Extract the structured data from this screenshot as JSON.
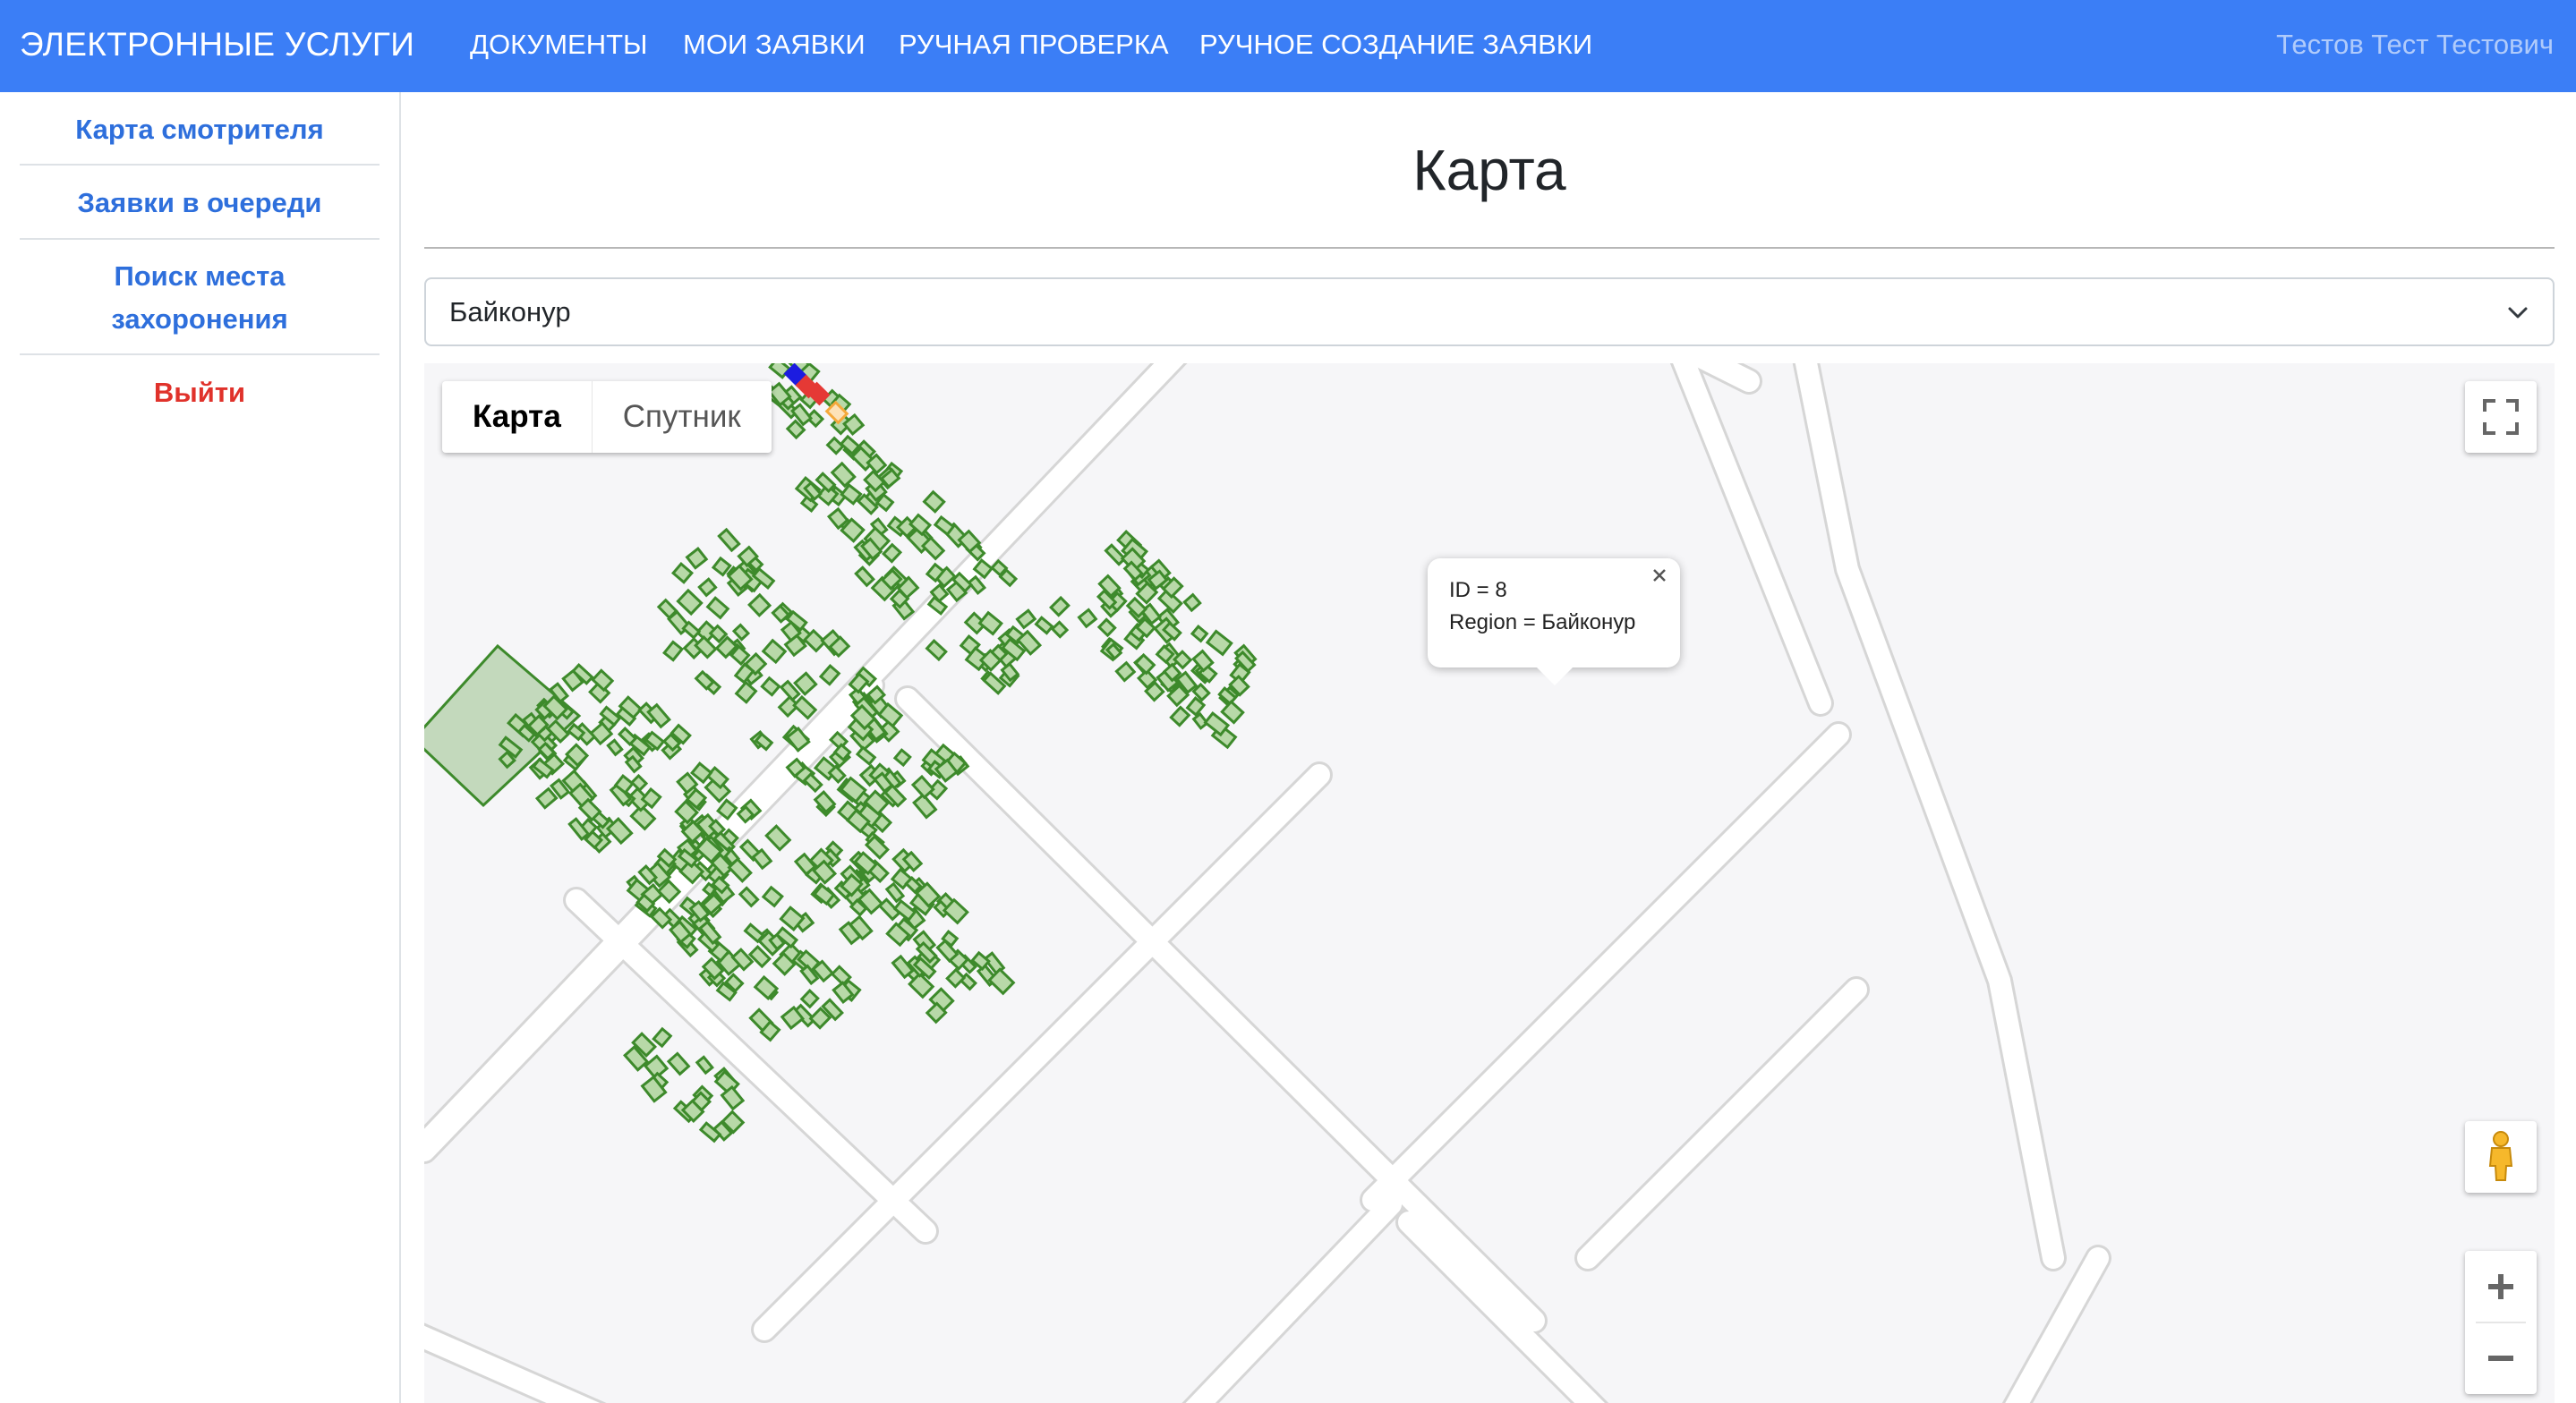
{
  "navbar": {
    "brand": "ЭЛЕКТРОННЫЕ УСЛУГИ",
    "items": [
      {
        "label": "ДОКУМЕНТЫ"
      },
      {
        "label": "МОИ ЗАЯВКИ"
      },
      {
        "label": "РУЧНАЯ ПРОВЕРКА"
      },
      {
        "label": "РУЧНОЕ СОЗДАНИЕ ЗАЯВКИ"
      }
    ],
    "user": "Тестов Тест Тестович",
    "color": "#3b7ef6"
  },
  "sidebar": {
    "items": [
      {
        "label": "Карта смотрителя"
      },
      {
        "label": "Заявки в очереди"
      },
      {
        "label_line1": "Поиск места",
        "label_line2": "захоронения"
      }
    ],
    "logout": "Выйти",
    "link_color": "#2e6fdc",
    "logout_color": "#e0322b"
  },
  "main": {
    "title": "Карта",
    "region_select": {
      "value": "Байконур",
      "icon": "chevron-down-icon"
    }
  },
  "map": {
    "type_buttons": [
      {
        "label": "Карта",
        "active": true
      },
      {
        "label": "Спутник",
        "active": false
      }
    ],
    "popup": {
      "line1": "ID = 8",
      "line2": "Region = Байконур"
    },
    "controls": {
      "fullscreen": "fullscreen-icon",
      "street_view": "pegman-icon",
      "zoom_in": "plus-icon",
      "zoom_out": "minus-icon"
    },
    "plot_colors": {
      "default": "#3d8a2b",
      "fill": "#b8d9a8",
      "blue": "#1c1ce0",
      "red": "#e53935",
      "orange": "#f5a93b"
    }
  }
}
